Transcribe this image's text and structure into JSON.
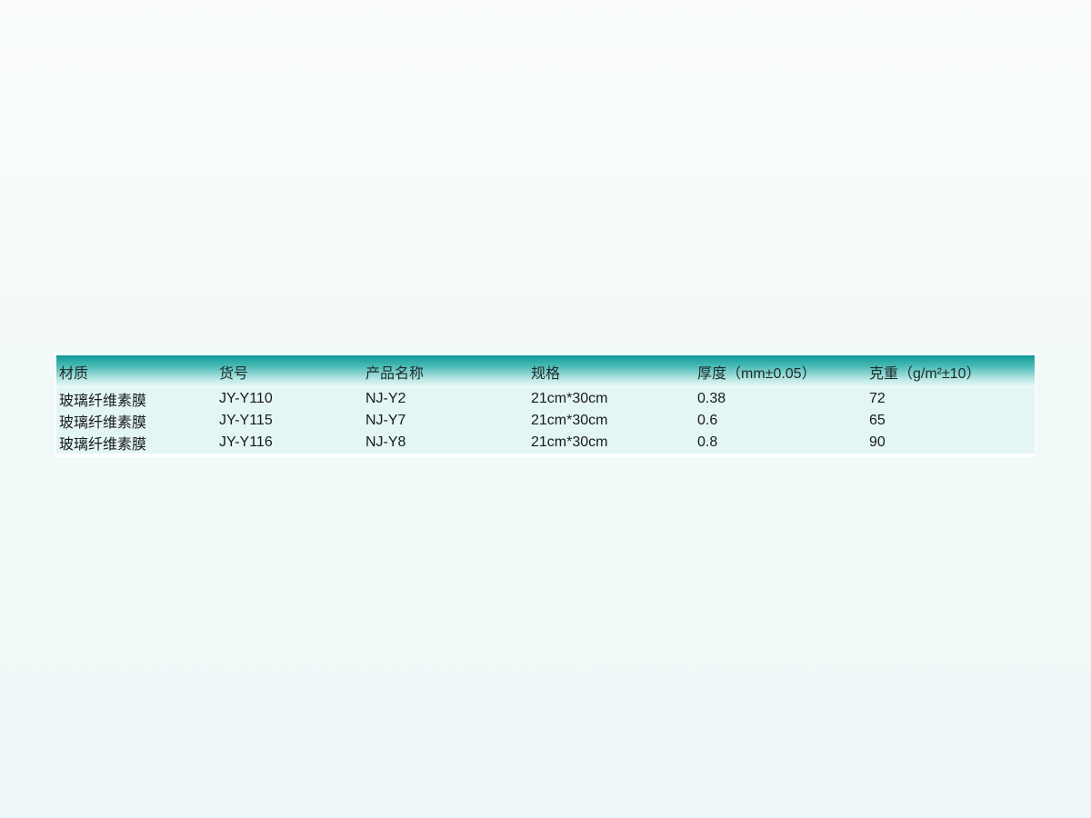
{
  "table": {
    "headers": [
      "材质",
      "货号",
      "产品名称",
      "规格",
      "厚度（mm±0.05）",
      "克重（g/m²±10）"
    ],
    "rows": [
      [
        "玻璃纤维素膜",
        "JY-Y110",
        "NJ-Y2",
        "21cm*30cm",
        "0.38",
        "72"
      ],
      [
        "玻璃纤维素膜",
        "JY-Y115",
        "NJ-Y7",
        "21cm*30cm",
        "0.6",
        "65"
      ],
      [
        "玻璃纤维素膜",
        "JY-Y116",
        "NJ-Y8",
        "21cm*30cm",
        "0.8",
        "90"
      ]
    ]
  },
  "colors": {
    "header_gradient_top": "#0e9a96",
    "row_background": "#e3f6f5"
  }
}
